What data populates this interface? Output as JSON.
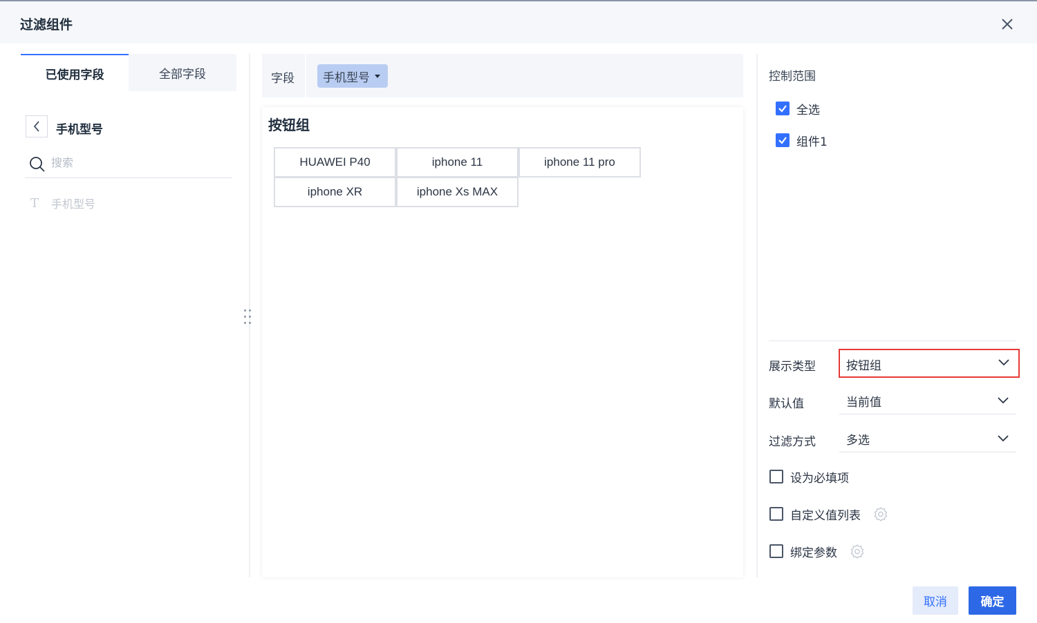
{
  "dialog": {
    "title": "过滤组件"
  },
  "left_panel": {
    "tabs": [
      {
        "label": "已使用字段"
      },
      {
        "label": "全部字段"
      }
    ],
    "current_field": "手机型号",
    "search": {
      "placeholder": "搜索",
      "value": ""
    },
    "fields": [
      {
        "label": "手机型号",
        "type_icon": "T"
      }
    ]
  },
  "center_panel": {
    "field_label": "字段",
    "field_chip": "手机型号",
    "preview_title": "按钮组",
    "buttons": [
      "HUAWEI P40",
      "iphone 11",
      "iphone 11 pro",
      "iphone XR",
      "iphone Xs MAX"
    ]
  },
  "right_panel": {
    "scope_title": "控制范围",
    "scope_items": [
      {
        "label": "全选",
        "checked": true
      },
      {
        "label": "组件1",
        "checked": true
      }
    ],
    "props": [
      {
        "label": "展示类型",
        "value": "按钮组"
      },
      {
        "label": "默认值",
        "value": "当前值"
      },
      {
        "label": "过滤方式",
        "value": "多选"
      }
    ],
    "options": [
      {
        "label": "设为必填项",
        "checked": false
      },
      {
        "label": "自定义值列表",
        "checked": false
      },
      {
        "label": "绑定参数",
        "checked": false
      }
    ]
  },
  "footer": {
    "cancel_label": "取消",
    "ok_label": "确定"
  },
  "colors": {
    "accent": "#3370ff",
    "highlight_border": "#e53935",
    "chip_bg": "#b9cdf2"
  }
}
